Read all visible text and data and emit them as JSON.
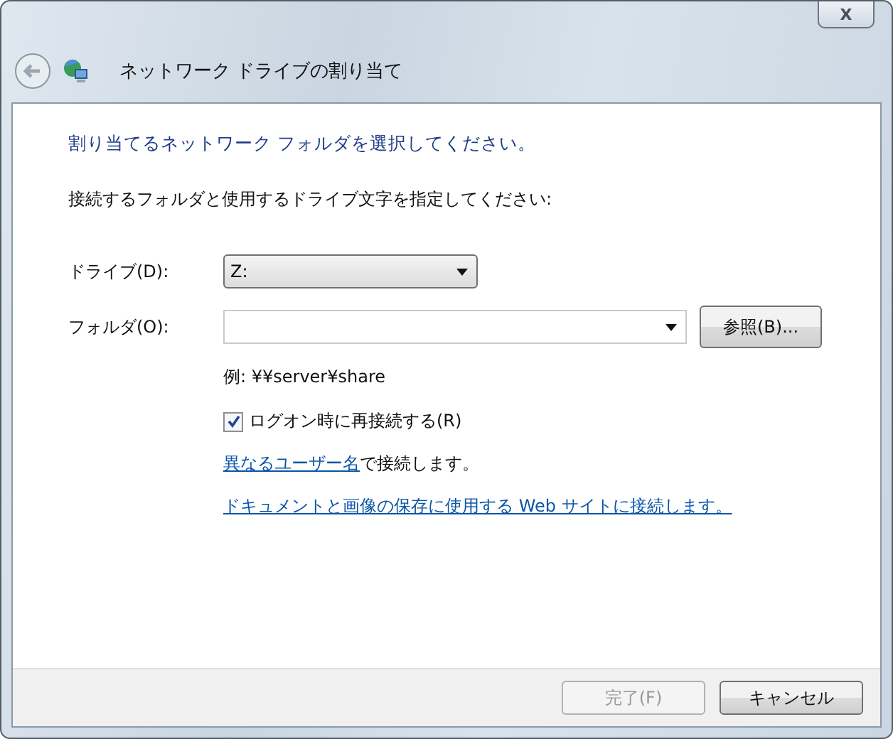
{
  "window": {
    "title": "ネットワーク ドライブの割り当て",
    "close_label": "X"
  },
  "heading": "割り当てるネットワーク フォルダを選択してください。",
  "instruction": "接続するフォルダと使用するドライブ文字を指定してください:",
  "drive": {
    "label": "ドライブ(D):",
    "value": "Z:"
  },
  "folder": {
    "label": "フォルダ(O):",
    "browse": "参照(B)..."
  },
  "example": "例: ¥¥server¥share",
  "reconnect": {
    "label": "ログオン時に再接続する(R)",
    "checked": true
  },
  "other_user": {
    "link": "異なるユーザー名",
    "rest": "で接続します。"
  },
  "website_link": "ドキュメントと画像の保存に使用する Web サイトに接続します。",
  "buttons": [
    {
      "label": "完了(F)",
      "disabled": true
    },
    {
      "label": "キャンセル",
      "disabled": false
    }
  ]
}
